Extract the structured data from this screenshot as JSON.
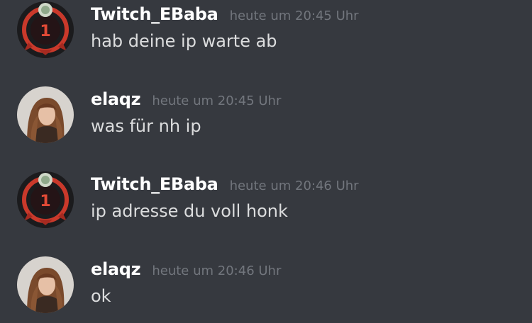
{
  "messages": [
    {
      "author": "Twitch_EBaba",
      "timestamp": "heute um 20:45 Uhr",
      "text": "hab deine ip warte ab",
      "avatar": "ebaba-avatar",
      "badge": "1"
    },
    {
      "author": "elaqz",
      "timestamp": "heute um 20:45 Uhr",
      "text": "was für nh ip",
      "avatar": "elaqz-avatar"
    },
    {
      "author": "Twitch_EBaba",
      "timestamp": "heute um 20:46 Uhr",
      "text": "ip adresse du voll honk",
      "avatar": "ebaba-avatar",
      "badge": "1"
    },
    {
      "author": "elaqz",
      "timestamp": "heute um 20:46 Uhr",
      "text": "ok",
      "avatar": "elaqz-avatar"
    }
  ],
  "colors": {
    "background": "#36393f",
    "username": "#ffffff",
    "timestamp": "#72767d",
    "message_text": "#dcddde",
    "ebaba_ring": "#c9392b"
  }
}
